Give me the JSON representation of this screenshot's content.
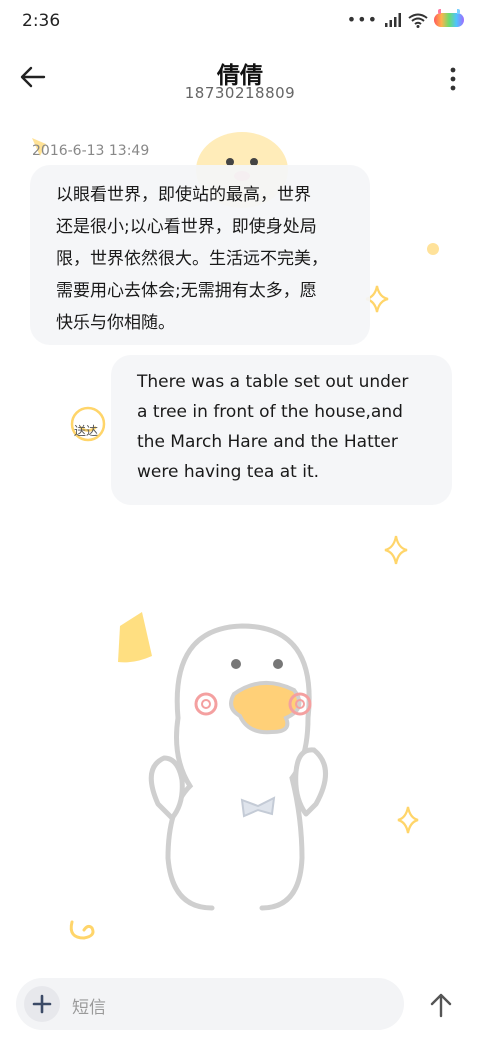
{
  "status_bar": {
    "time": "2:36"
  },
  "header": {
    "title": "倩倩",
    "phone": "18730218809"
  },
  "conversation": {
    "timestamp": "2016-6-13 13:49",
    "incoming_lines": [
      "以眼看世界，即使站的最高，世界",
      "还是很小;以心看世界，即使身处局",
      "限，世界依然很大。生活远不完美，",
      "需要用心去体会;无需拥有太多，愿",
      "快乐与你相随。"
    ],
    "outgoing_lines": [
      "There was a table set out under",
      "a tree in front of the house,and",
      "the March Hare and the Hatter",
      "were having tea at it."
    ],
    "delivery_status": "送达"
  },
  "composer": {
    "placeholder": "短信"
  },
  "icons": {
    "back": "arrow-left-icon",
    "more": "more-vertical-icon",
    "add": "plus-icon",
    "send": "arrow-up-icon",
    "wifi": "wifi-icon",
    "signal": "signal-icon",
    "battery": "battery-icon"
  },
  "colors": {
    "bubble": "#f4f5f7",
    "decoration_yellow": "#ffd56a",
    "accent_blue": "#3b4a66"
  }
}
